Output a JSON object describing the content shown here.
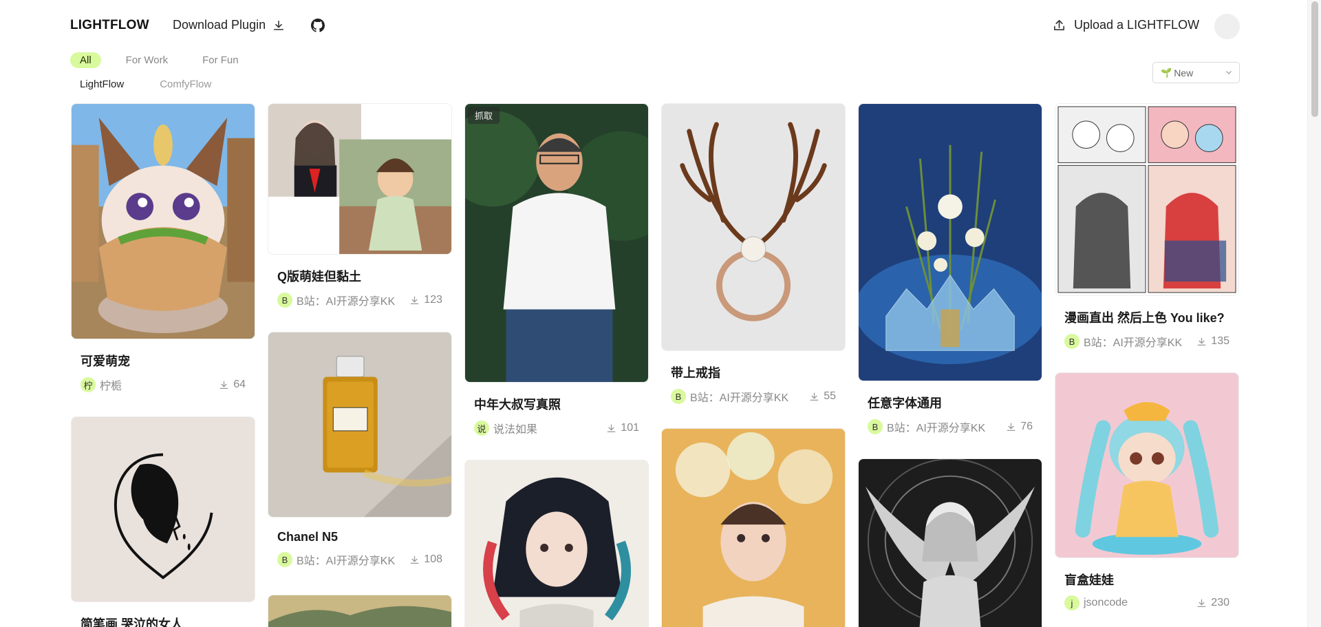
{
  "header": {
    "brand": "LIGHTFLOW",
    "download_plugin": "Download Plugin",
    "upload": "Upload a LIGHTFLOW"
  },
  "filters": {
    "pills": [
      "All",
      "For Work",
      "For Fun"
    ],
    "active_pill": "All",
    "subtabs": [
      "LightFlow",
      "ComfyFlow"
    ],
    "active_subtab": "LightFlow",
    "sort_label": "New"
  },
  "cards": [
    {
      "title": "可爱萌宠",
      "author": "柠栀",
      "avatar": "柠",
      "downloads": "64"
    },
    {
      "title": "简笔画 哭泣的女人",
      "author": "",
      "avatar": "",
      "downloads": ""
    },
    {
      "title": "Q版萌娃但黏土",
      "author": "B站：AI开源分享KK",
      "avatar": "B",
      "downloads": "123"
    },
    {
      "title": "Chanel N5",
      "author": "B站：AI开源分享KK",
      "avatar": "B",
      "downloads": "108"
    },
    {
      "title": "中年大叔写真照",
      "author": "说法如果",
      "avatar": "说",
      "downloads": "101"
    },
    {
      "title": "带上戒指",
      "author": "B站：AI开源分享KK",
      "avatar": "B",
      "downloads": "55"
    },
    {
      "title": "任意字体通用",
      "author": "B站：AI开源分享KK",
      "avatar": "B",
      "downloads": "76"
    },
    {
      "title": "漫画直出 然后上色 You like?",
      "author": "B站：AI开源分享KK",
      "avatar": "B",
      "downloads": "135"
    },
    {
      "title": "盲盒娃娃",
      "author": "jsoncode",
      "avatar": "j",
      "downloads": "230"
    }
  ],
  "overlay": {
    "grab_label": "抓取"
  },
  "colors": {
    "accent": "#d9f99d"
  }
}
